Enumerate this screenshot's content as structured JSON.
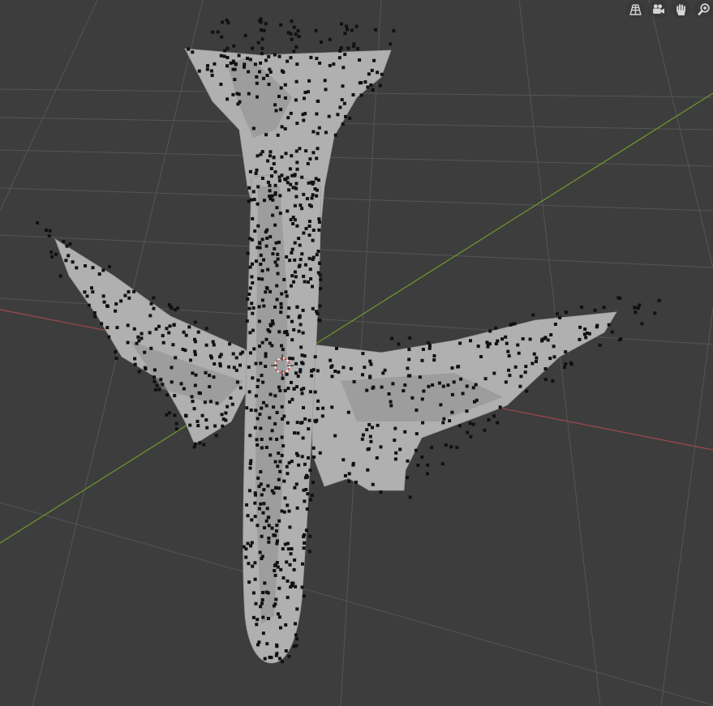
{
  "viewport": {
    "background": "#3d3d3d",
    "grid_color": "#555555",
    "x_axis_color": "#a2474f",
    "y_axis_color": "#6e9a2b",
    "mesh_color": "#b0b0b0",
    "point_color": "#111111",
    "object_shown": "airplane-point-cloud-mesh",
    "origin_marker": "3d-cursor"
  },
  "nav_gizmos": [
    {
      "name": "toggle-perspective",
      "icon": "grid-perspective-icon"
    },
    {
      "name": "camera-view",
      "icon": "camera-icon"
    },
    {
      "name": "pan-view",
      "icon": "hand-icon"
    },
    {
      "name": "zoom-view",
      "icon": "magnifier-plus-icon"
    }
  ]
}
